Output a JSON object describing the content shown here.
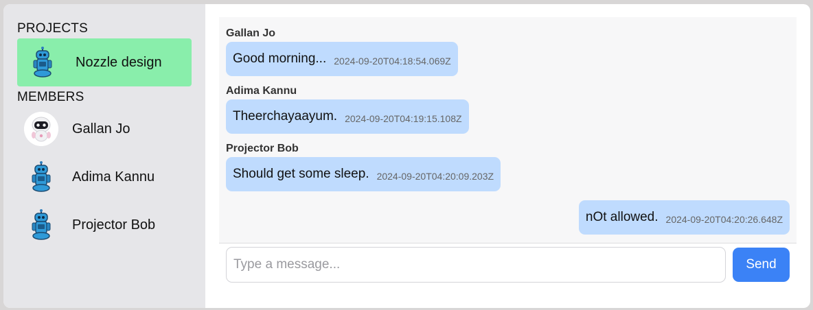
{
  "sidebar": {
    "projects_title": "PROJECTS",
    "members_title": "MEMBERS",
    "projects": [
      {
        "label": "Nozzle design",
        "icon": "robot-icon",
        "active": true,
        "highlight_color": "#89eeab"
      }
    ],
    "members": [
      {
        "label": "Gallan Jo",
        "icon": "white-robot-avatar"
      },
      {
        "label": "Adima Kannu",
        "icon": "robot-icon"
      },
      {
        "label": "Projector Bob",
        "icon": "robot-icon"
      }
    ]
  },
  "chat": {
    "messages": [
      {
        "sender": "Gallan Jo",
        "text": "Good morning...",
        "time": "2024-09-20T04:18:54.069Z"
      },
      {
        "sender": "Adima Kannu",
        "text": "Theerchayaayum.",
        "time": "2024-09-20T04:19:15.108Z"
      },
      {
        "sender": "Projector Bob",
        "text": "Should get some sleep.",
        "time": "2024-09-20T04:20:09.203Z"
      },
      {
        "sender": "",
        "text": "nOt allowed.",
        "time": "2024-09-20T04:20:26.648Z",
        "self": true
      }
    ],
    "bubble_color": "#bfdbfe"
  },
  "composer": {
    "placeholder": "Type a message...",
    "value": "",
    "send_label": "Send",
    "send_color": "#3b82f6"
  }
}
